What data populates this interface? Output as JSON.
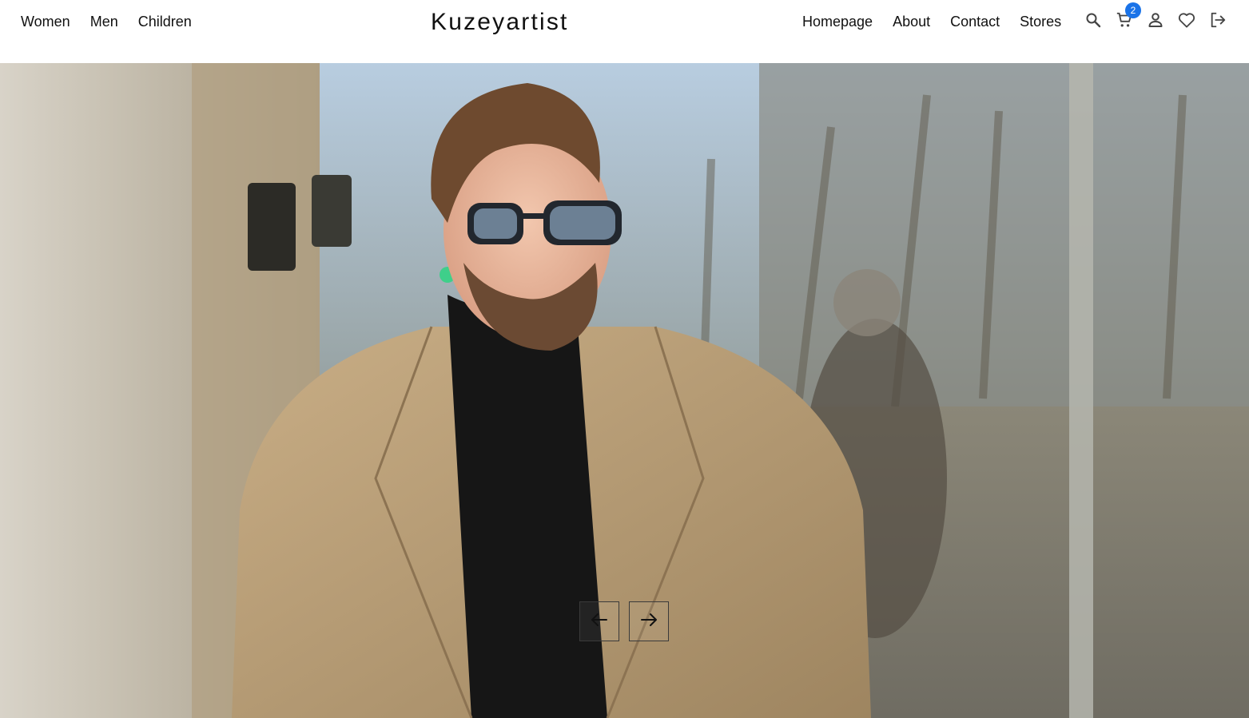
{
  "brand": {
    "name": "Kuzeyartist"
  },
  "nav_left": [
    {
      "label": "Women"
    },
    {
      "label": "Men"
    },
    {
      "label": "Children"
    }
  ],
  "nav_right": [
    {
      "label": "Homepage"
    },
    {
      "label": "About"
    },
    {
      "label": "Contact"
    },
    {
      "label": "Stores"
    }
  ],
  "icons": {
    "search": "search-icon",
    "cart": "cart-icon",
    "user": "user-icon",
    "wishlist": "heart-icon",
    "logout": "logout-icon"
  },
  "cart": {
    "count": "2"
  },
  "hero": {
    "image": "Man with sunglasses, black turtleneck and camel coat on a sunny city street",
    "prev_icon": "arrow-left-icon",
    "next_icon": "arrow-right-icon"
  },
  "colors": {
    "badge": "#1a73e8",
    "text": "#111111",
    "background": "#ffffff"
  }
}
